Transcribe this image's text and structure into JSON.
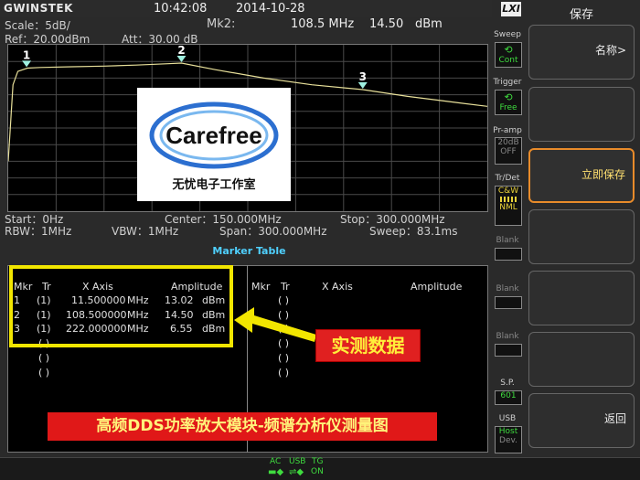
{
  "brand": "GWINSTEK",
  "lxi": "LXI",
  "topbar": {
    "time": "10:42:08",
    "date": "2014-10-28"
  },
  "readout": {
    "scale": "Scale：5dB/",
    "ref": "Ref：20.00dBm",
    "att": "Att：30.00 dB",
    "marker_name": "Mk2:",
    "marker_freq": "108.5 MHz",
    "marker_amp": "14.50",
    "marker_unit": "dBm"
  },
  "footer_params": {
    "start": "Start：0Hz",
    "center": "Center：150.000MHz",
    "stop": "Stop：300.000MHz",
    "rbw": "RBW：1MHz",
    "vbw": "VBW：1MHz",
    "span": "Span：300.000MHz",
    "sweep": "Sweep：83.1ms"
  },
  "chart_data": {
    "type": "line",
    "x_range": [
      0,
      300
    ],
    "x_unit": "MHz",
    "y_reference": 20,
    "y_scale_per_div": 5,
    "y_divisions": 10,
    "y_unit": "dBm",
    "grid": true,
    "trace": {
      "x": [
        0,
        3,
        6,
        9,
        12,
        20,
        40,
        60,
        80,
        100,
        108.5,
        130,
        160,
        190,
        222,
        250,
        275,
        300
      ],
      "y": [
        -15,
        8,
        12,
        12.5,
        13,
        13.2,
        13.4,
        13.6,
        13.9,
        14.3,
        14.5,
        12.5,
        10,
        8,
        6.55,
        4.5,
        3,
        1.5
      ]
    },
    "markers": [
      {
        "label": "1",
        "x": 11.5,
        "y": 13.02
      },
      {
        "label": "2",
        "x": 108.5,
        "y": 14.5
      },
      {
        "label": "3",
        "x": 222,
        "y": 6.55
      }
    ]
  },
  "marker_table": {
    "title": "Marker Table",
    "headers": {
      "mkr": "Mkr",
      "tr": "Tr",
      "x": "X Axis",
      "amp": "Amplitude"
    },
    "rows": [
      {
        "mkr": "1",
        "tr": "(1)",
        "x": "11.500000",
        "xu": "MHz",
        "amp": "13.02",
        "au": "dBm"
      },
      {
        "mkr": "2",
        "tr": "(1)",
        "x": "108.500000",
        "xu": "MHz",
        "amp": "14.50",
        "au": "dBm"
      },
      {
        "mkr": "3",
        "tr": "(1)",
        "x": "222.000000",
        "xu": "MHz",
        "amp": "6.55",
        "au": "dBm"
      },
      {
        "mkr": "",
        "tr": "( )",
        "x": "",
        "xu": "",
        "amp": "",
        "au": ""
      },
      {
        "mkr": "",
        "tr": "( )",
        "x": "",
        "xu": "",
        "amp": "",
        "au": ""
      },
      {
        "mkr": "",
        "tr": "( )",
        "x": "",
        "xu": "",
        "amp": "",
        "au": ""
      }
    ],
    "right_rows": [
      "( )",
      "( )",
      "( )",
      "( )",
      "( )",
      "( )",
      "( )"
    ]
  },
  "annotations": {
    "callout": "实测数据",
    "banner": "高频DDS功率放大模块-频谱分析仪测量图",
    "card_brand": "Carefree",
    "card_subtitle": "无忧电子工作室"
  },
  "side_strip": {
    "sweep": {
      "label": "Sweep",
      "value": "Cont"
    },
    "trigger": {
      "label": "Trigger",
      "value": "Free"
    },
    "pramp": {
      "label": "Pr-amp",
      "v1": "20dB",
      "v2": "OFF"
    },
    "trdet": {
      "label": "Tr/Det",
      "value": "C&W",
      "value2": "NML"
    },
    "blank1": "Blank",
    "blank2": "Blank",
    "blank3": "Blank",
    "sp_label": "S.P.",
    "sp_value": "601",
    "usb_label": "USB",
    "usb_v1": "Host",
    "usb_v2": "Dev."
  },
  "menu": {
    "title": "保存",
    "key1": "名称>",
    "key2": "",
    "key3": "立即保存",
    "key4": "",
    "key5": "",
    "key6": "",
    "key7": "返回"
  },
  "status": {
    "ac": "AC",
    "usb": "USB",
    "tg": "TG",
    "tg_state": "ON"
  },
  "colors": {
    "trace": "#e8e09a",
    "marker": "#9ff0e0",
    "highlight": "#f2e600",
    "callout_bg": "#e02020",
    "active_key": "#e88b2a",
    "cyan": "#4fd0ff",
    "green": "#34d034"
  }
}
